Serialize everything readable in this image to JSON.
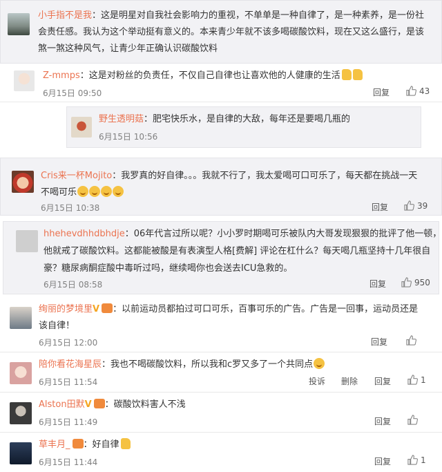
{
  "comments": [
    {
      "username": "小手指不是我",
      "lines": [
        "：这是明星对自我社会影响力的重视，不单单是一种自律了，是一种素养，是一份社",
        "会责任感。我认为这个举动挺有意义的。本来青少年就不该多喝碳酸饮料，现在又这么盛行，是该",
        "煞一煞这种风气，让青少年正确认识碳酸饮料"
      ]
    },
    {
      "username": "Z-mmps",
      "text": "：这是对粉丝的负责任，不仅自己自律也让喜欢他的人健康的生活",
      "date": "6月15日 09:50",
      "reply": "回复",
      "likes": "43"
    },
    {
      "username": "野生透明菇",
      "text": "：肥宅快乐水，是自律的大敌，每年还是要喝几瓶的",
      "date": "6月15日 10:56"
    },
    {
      "username": "Cris来一杯Mojito",
      "line1": "：我罗真的好自律。。。我就不行了，我太爱喝可口可乐了，每天都在挑战一天",
      "line2": "不喝可乐",
      "date": "6月15日 10:38",
      "reply": "回复",
      "likes": "39"
    },
    {
      "username": "hhehevdhhdbhdje",
      "lines": [
        "：06年代言过所以呢？小小罗时期喝可乐被队内大哥发现狠狠的批评了他一顿，",
        "他就戒了碳酸饮料。这都能被酸是有表演型人格[费解] 评论在杠什么？每天喝几瓶坚持十几年很自",
        "豪？糖尿病酮症酸中毒听过吗，继续喝你也会送去ICU急救的。"
      ],
      "date": "6月15日 08:58",
      "reply": "回复",
      "likes": "950"
    },
    {
      "username": "绚丽的梦境里",
      "line1": "：以前运动员都拍过可口可乐，百事可乐的广告。广告是一回事，运动员还是",
      "line2": "该自律！",
      "date": "6月15日 12:00",
      "reply": "回复"
    },
    {
      "username": "陪你看花海星辰",
      "text": "：我也不喝碳酸饮料，所以我和c罗又多了一个共同点",
      "date": "6月15日 11:54",
      "report": "投诉",
      "delete": "删除",
      "reply": "回复",
      "likes": "1"
    },
    {
      "username": "Alston田默",
      "text": "：碳酸饮料害人不浅",
      "date": "6月15日 11:49",
      "reply": "回复"
    },
    {
      "username": "草丰月_",
      "text": "：好自律",
      "date": "6月15日 11:44",
      "reply": "回复",
      "likes": "1"
    }
  ],
  "icons": {
    "like": "thumbs-up-icon",
    "verified": "V",
    "emoji": "smile-emoji"
  },
  "colors": {
    "username": "#eb7350",
    "card_bg": "#f2f2f5",
    "text": "#333333",
    "meta": "#808080"
  }
}
